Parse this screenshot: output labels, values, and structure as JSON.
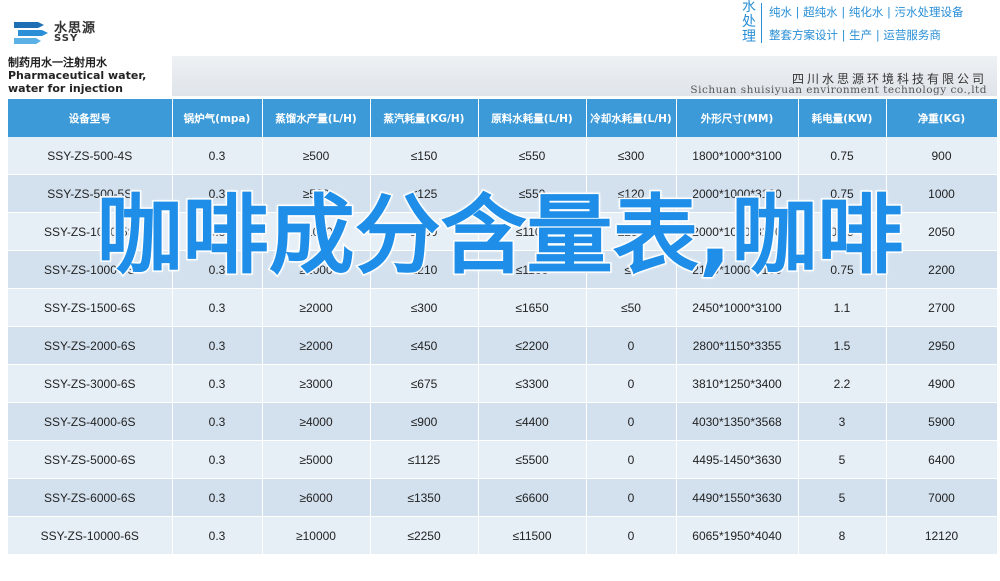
{
  "brand": {
    "logo_cn": "水思源",
    "logo_en": "SSY",
    "logo_icon": "stacked-arrows-logo-icon",
    "vertical_label": [
      "水",
      "处",
      "理"
    ],
    "line1": "纯水 | 超纯水 | 纯化水 | 污水处理设备",
    "line2": "整套方案设计 | 生产 | 运营服务商"
  },
  "title": {
    "cn": "制药用水一注射用水",
    "en": "Pharmaceutical water, water for injection"
  },
  "company": {
    "cn": "四川水思源环境科技有限公司",
    "en": "Sichuan shuisiyuan environment technology co.,ltd"
  },
  "table": {
    "headers": [
      "设备型号",
      "锅炉气(mpa)",
      "蒸馏水产量(L/H)",
      "蒸汽耗量(KG/H)",
      "原料水耗量(L/H)",
      "冷却水耗量(L/H)",
      "外形尺寸(MM)",
      "耗电量(KW)",
      "净重(KG)"
    ],
    "rows": [
      [
        "SSY-ZS-500-4S",
        "0.3",
        "≥500",
        "≤150",
        "≤550",
        "≤300",
        "1800*1000*3100",
        "0.75",
        "900"
      ],
      [
        "SSY-ZS-500-5S",
        "0.3",
        "≥500",
        "≤125",
        "≤550",
        "≤120",
        "2000*1000*3100",
        "0.75",
        "1000"
      ],
      [
        "SSY-ZS-1000-5S",
        "0.3",
        "≥1000",
        "≤250",
        "≤1100",
        "≤250",
        "2000*1000*3100",
        "0.75",
        "2050"
      ],
      [
        "SSY-ZS-1000-6S",
        "0.3",
        "≥1000",
        "≤210",
        "≤1100",
        "≤0",
        "2100*1000*3100",
        "0.75",
        "2200"
      ],
      [
        "SSY-ZS-1500-6S",
        "0.3",
        "≥2000",
        "≤300",
        "≤1650",
        "≤50",
        "2450*1000*3100",
        "1.1",
        "2700"
      ],
      [
        "SSY-ZS-2000-6S",
        "0.3",
        "≥2000",
        "≤450",
        "≤2200",
        "0",
        "2800*1150*3355",
        "1.5",
        "2950"
      ],
      [
        "SSY-ZS-3000-6S",
        "0.3",
        "≥3000",
        "≤675",
        "≤3300",
        "0",
        "3810*1250*3400",
        "2.2",
        "4900"
      ],
      [
        "SSY-ZS-4000-6S",
        "0.3",
        "≥4000",
        "≤900",
        "≤4400",
        "0",
        "4030*1350*3568",
        "3",
        "5900"
      ],
      [
        "SSY-ZS-5000-6S",
        "0.3",
        "≥5000",
        "≤1125",
        "≤5500",
        "0",
        "4495-1450*3630",
        "5",
        "6400"
      ],
      [
        "SSY-ZS-6000-6S",
        "0.3",
        "≥6000",
        "≤1350",
        "≤6600",
        "0",
        "4490*1550*3630",
        "5",
        "7000"
      ],
      [
        "SSY-ZS-10000-6S",
        "0.3",
        "≥10000",
        "≤2250",
        "≤11500",
        "0",
        "6065*1950*4040",
        "8",
        "12120"
      ]
    ]
  },
  "overlay": {
    "text": "咖啡成分含量表,咖啡"
  }
}
